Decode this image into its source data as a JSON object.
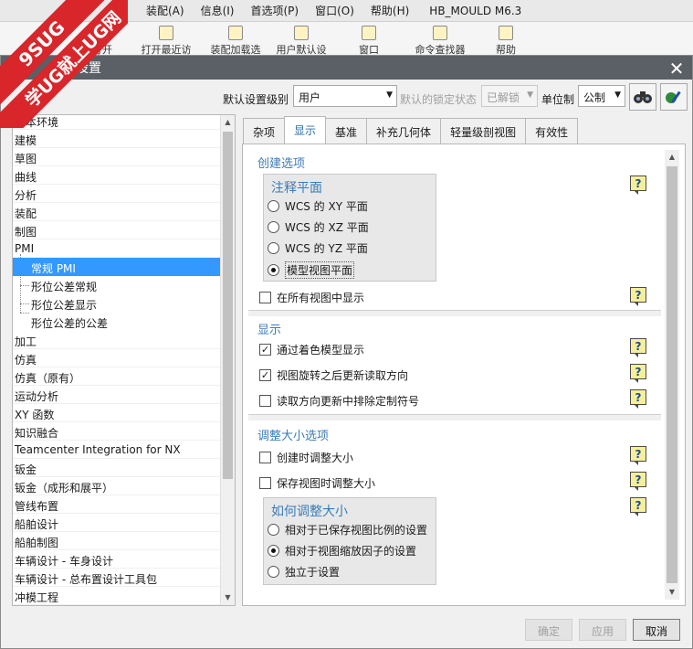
{
  "app": {
    "menu": [
      "装配(A)",
      "信息(I)",
      "首选项(P)",
      "窗口(O)",
      "帮助(H)"
    ],
    "title": "HB_MOULD M6.3",
    "toolbar": [
      "打开最近访问",
      "装配加载选",
      "用户默认设",
      "窗口",
      "命令查找器",
      "帮助"
    ],
    "partial_tool": "打开"
  },
  "watermark": {
    "line1": "9SUG",
    "line2": "学UG就上UG网"
  },
  "dialog": {
    "title": "设置",
    "close_icon": "close-icon",
    "level_label": "默认设置级别",
    "level_value": "用户",
    "lock_label": "默认的锁定状态",
    "lock_value": "已解锁",
    "unit_label": "单位制",
    "unit_value": "公制"
  },
  "tree": {
    "items": [
      "基本环境",
      "建模",
      "草图",
      "曲线",
      "分析",
      "装配",
      "制图",
      "PMI",
      "常规 PMI",
      "形位公差常规",
      "形位公差显示",
      "形位公差的公差",
      "加工",
      "仿真",
      "仿真（原有）",
      "运动分析",
      "XY 函数",
      "知识融合",
      "Teamcenter Integration for NX",
      "钣金",
      "钣金（成形和展平）",
      "管线布置",
      "船舶设计",
      "船舶制图",
      "车辆设计 - 车身设计",
      "车辆设计 - 总布置设计工具包",
      "冲模工程"
    ]
  },
  "tabs": [
    "杂项",
    "显示",
    "基准",
    "补充几何体",
    "轻量级剖视图",
    "有效性"
  ],
  "create": {
    "title": "创建选项",
    "plane_title": "注释平面",
    "options": [
      "WCS 的 XY 平面",
      "WCS 的 XZ 平面",
      "WCS 的 YZ 平面",
      "模型视图平面"
    ],
    "selected_index": 3,
    "show_all_views": "在所有视图中显示"
  },
  "display": {
    "title": "显示",
    "shaded": "通过着色模型显示",
    "update_after_rotate": "视图旋转之后更新读取方向",
    "exclude_custom": "读取方向更新中排除定制符号"
  },
  "resize": {
    "title": "调整大小选项",
    "on_create": "创建时调整大小",
    "on_save_view": "保存视图时调整大小",
    "how_title": "如何调整大小",
    "how_options": [
      "相对于已保存视图比例的设置",
      "相对于视图缩放因子的设置",
      "独立于设置"
    ],
    "how_selected": 1
  },
  "footer": {
    "ok": "确定",
    "apply": "应用",
    "cancel": "取消"
  }
}
